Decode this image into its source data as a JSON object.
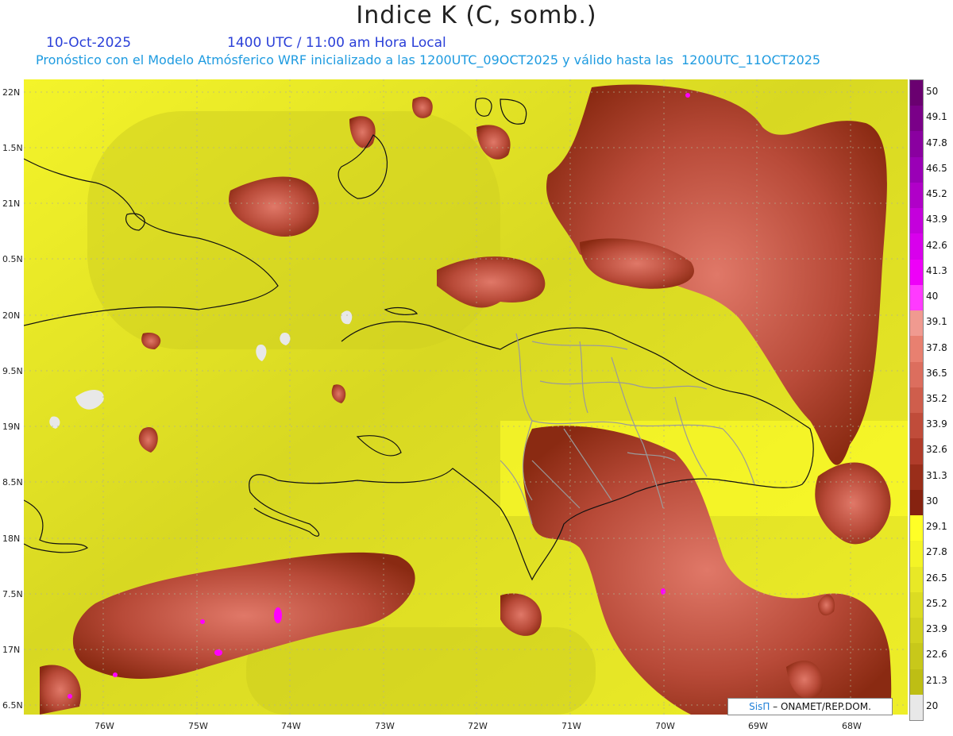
{
  "header": {
    "title": "Indice K (C, somb.)",
    "date": "10-Oct-2025",
    "time": "1400 UTC / 11:00 am Hora Local",
    "description": "Pronóstico con el Modelo Atmósferico WRF inicializado a las 1200UTC_09OCT2025 y válido hasta las  1200UTC_11OCT2025"
  },
  "map": {
    "lat_labels": [
      "22N",
      "1.5N",
      "21N",
      "0.5N",
      "20N",
      "9.5N",
      "19N",
      "8.5N",
      "18N",
      "7.5N",
      "17N",
      "6.5N"
    ],
    "lon_labels": [
      "76W",
      "75W",
      "74W",
      "73W",
      "72W",
      "71W",
      "70W",
      "69W",
      "68W"
    ],
    "colors": {
      "below_20": "#e6e6e6",
      "yellow_low": "#c8c81e",
      "yellow_high": "#ffff2a",
      "brown_low": "#8a2a10",
      "brown_high": "#e88070",
      "pink": "#ff00ff"
    }
  },
  "colorbar": {
    "labels": [
      "50",
      "49.1",
      "47.8",
      "46.5",
      "45.2",
      "43.9",
      "42.6",
      "41.3",
      "40",
      "39.1",
      "37.8",
      "36.5",
      "35.2",
      "33.9",
      "32.6",
      "31.3",
      "30",
      "29.1",
      "27.8",
      "26.5",
      "25.2",
      "23.9",
      "22.6",
      "21.3",
      "20"
    ],
    "colors": [
      "#6a0070",
      "#7a0088",
      "#8a00a0",
      "#9a00b6",
      "#b000c8",
      "#c400dc",
      "#d800ec",
      "#ee00f8",
      "#ff3aff",
      "#f09a90",
      "#e88070",
      "#dc6e5e",
      "#cf5e4c",
      "#c04c3a",
      "#b03c2a",
      "#9a2e1a",
      "#862210",
      "#ffff26",
      "#f4f426",
      "#e8e826",
      "#dcdc22",
      "#d2d21e",
      "#c8c81a",
      "#bebe14",
      "#e8e8e8"
    ]
  },
  "credit": {
    "brand": "SisΠ",
    "text": "– ONAMET/REP.DOM."
  }
}
